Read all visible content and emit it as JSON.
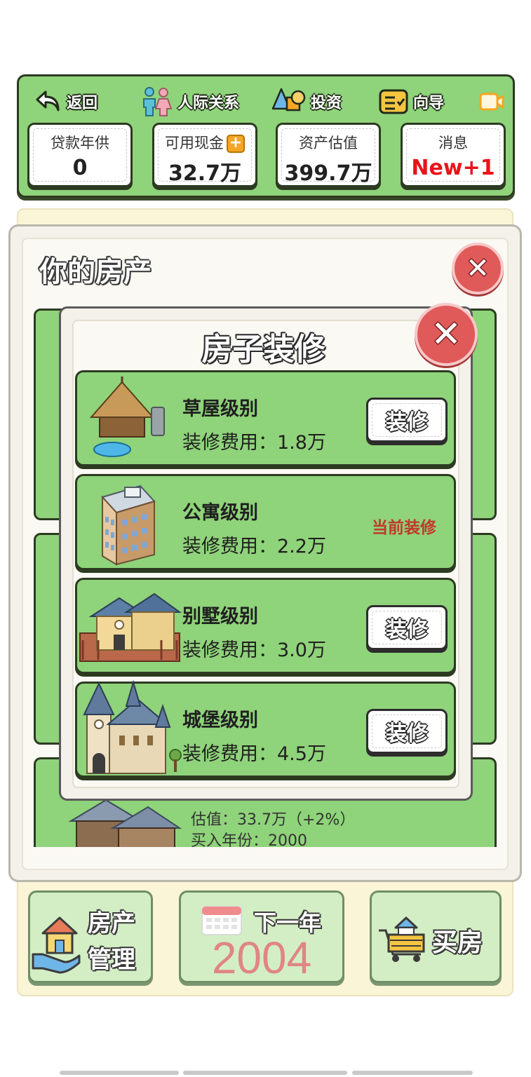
{
  "nav": {
    "back": "返回",
    "social": "人际关系",
    "invest": "投资",
    "guide": "向导"
  },
  "stats": [
    {
      "label": "贷款年供",
      "value": "0"
    },
    {
      "label": "可用现金",
      "value": "32.7万"
    },
    {
      "label": "资产估值",
      "value": "399.7万"
    },
    {
      "label": "消息",
      "value": "New+1"
    }
  ],
  "colors": {
    "panel_green": "#8fd37a",
    "new_badge": "#e8141b",
    "current_tag": "#c0392b",
    "year": "#e08585"
  },
  "property_panel": {
    "title": "你的房产",
    "visible_property": {
      "valuation": "估值：33.7万（+2%）",
      "purchase_year": "买入年份：2000"
    }
  },
  "renovation": {
    "title": "房子装修",
    "levels": [
      {
        "name": "草屋级别",
        "cost": "装修费用：1.8万",
        "action": "装修",
        "icon": "hut-icon"
      },
      {
        "name": "公寓级别",
        "cost": "装修费用：2.2万",
        "status": "当前装修",
        "icon": "apartment-icon"
      },
      {
        "name": "别墅级别",
        "cost": "装修费用：3.0万",
        "action": "装修",
        "icon": "villa-icon"
      },
      {
        "name": "城堡级别",
        "cost": "装修费用：4.5万",
        "action": "装修",
        "icon": "castle-icon"
      }
    ]
  },
  "bottom": {
    "manage_line1": "房产",
    "manage_line2": "管理",
    "next_label": "下一年",
    "year": "2004",
    "buy_label": "买房"
  }
}
